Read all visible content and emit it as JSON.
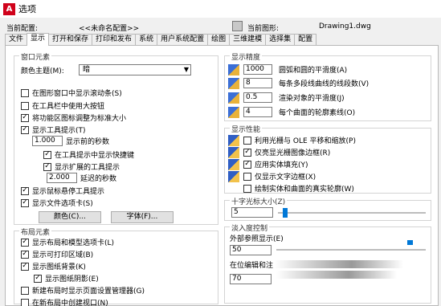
{
  "window": {
    "title": "选项",
    "icon_text": "A"
  },
  "config": {
    "current_config_label": "当前配置:",
    "current_config_value": "<<未命名配置>>",
    "current_drawing_label": "当前图形:",
    "current_drawing_value": "Drawing1.dwg"
  },
  "tabs": [
    "文件",
    "显示",
    "打开和保存",
    "打印和发布",
    "系统",
    "用户系统配置",
    "绘图",
    "三维建模",
    "选择集",
    "配置"
  ],
  "window_elements": {
    "title": "窗口元素",
    "theme_label": "颜色主题(M):",
    "theme_value": "暗",
    "scrollbars": "在图形窗口中显示滚动条(S)",
    "large_buttons": "在工具栏中使用大按钮",
    "resize_ribbon": "将功能区图标调整为标准大小",
    "tooltips": "显示工具提示(T)",
    "delay_value": "1.000",
    "delay_label": "显示前的秒数",
    "shortcut_keys": "在工具提示中显示快捷键",
    "extended_tooltips": "显示扩展的工具提示",
    "ext_delay_value": "2.000",
    "ext_delay_label": "延迟的秒数",
    "rollover": "显示鼠标悬停工具提示",
    "file_tabs": "显示文件选项卡(S)",
    "colors_button": "颜色(C)...",
    "fonts_button": "字体(F)..."
  },
  "layout_elements": {
    "title": "布局元素",
    "layout_model_tabs": "显示布局和模型选项卡(L)",
    "printable_area": "显示可打印区域(B)",
    "paper_background": "显示图纸背景(K)",
    "paper_shadow": "显示图纸阴影(E)",
    "page_setup_manager": "新建布局时显示页面设置管理器(G)",
    "create_viewport": "在新布局中创建视口(N)"
  },
  "display_resolution": {
    "title": "显示精度",
    "items": [
      {
        "value": "1000",
        "label": "圆弧和圆的平滑度(A)"
      },
      {
        "value": "8",
        "label": "每条多段线曲线的线段数(V)"
      },
      {
        "value": "0.5",
        "label": "渲染对象的平滑度(J)"
      },
      {
        "value": "4",
        "label": "每个曲面的轮廓素线(O)"
      }
    ]
  },
  "display_performance": {
    "title": "显示性能",
    "items": [
      {
        "label": "利用光栅与 OLE 平移和缩放(P)",
        "checked": false
      },
      {
        "label": "仅亮显光栅图像边框(R)",
        "checked": true
      },
      {
        "label": "应用实体填充(Y)",
        "checked": true
      },
      {
        "label": "仅显示文字边框(X)",
        "checked": false
      },
      {
        "label": "绘制实体和曲面的真实轮廓(W)",
        "checked": false
      }
    ]
  },
  "crosshair": {
    "title": "十字光标大小(Z)",
    "value": "5",
    "slider_fraction": 0.05
  },
  "fade_control": {
    "title": "淡入度控制",
    "xref_label": "外部参照显示(E)",
    "xref_value": "50",
    "xref_slider_fraction": 0.5,
    "inplace_label": "在位编辑和注",
    "inplace_value": "70"
  },
  "colors": {
    "accent": "#0078d7",
    "check_mark": "#000000",
    "app_icon": "#d0021b"
  }
}
